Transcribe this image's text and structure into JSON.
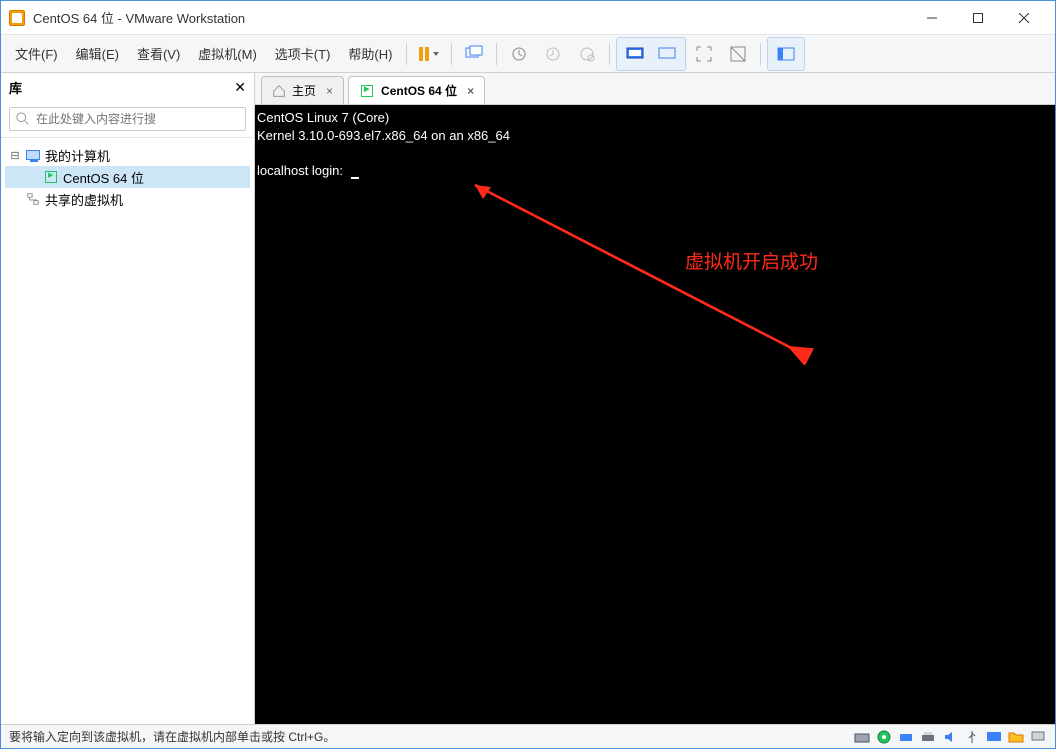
{
  "window": {
    "title": "CentOS 64 位 - VMware Workstation"
  },
  "menus": {
    "file": "文件(F)",
    "edit": "编辑(E)",
    "view": "查看(V)",
    "vm": "虚拟机(M)",
    "tabs": "选项卡(T)",
    "help": "帮助(H)"
  },
  "sidebar": {
    "title": "库",
    "search_placeholder": "在此处键入内容进行搜",
    "root": "我的计算机",
    "items": [
      "CentOS 64 位"
    ],
    "shared": "共享的虚拟机"
  },
  "tabs": {
    "home": "主页",
    "vm": "CentOS 64 位"
  },
  "console": {
    "line1": "CentOS Linux 7 (Core)",
    "line2": "Kernel 3.10.0-693.el7.x86_64 on an x86_64",
    "prompt": "localhost login: "
  },
  "annotation": {
    "text": "虚拟机开启成功"
  },
  "status": {
    "text": "要将输入定向到该虚拟机，请在虚拟机内部单击或按 Ctrl+G。"
  }
}
